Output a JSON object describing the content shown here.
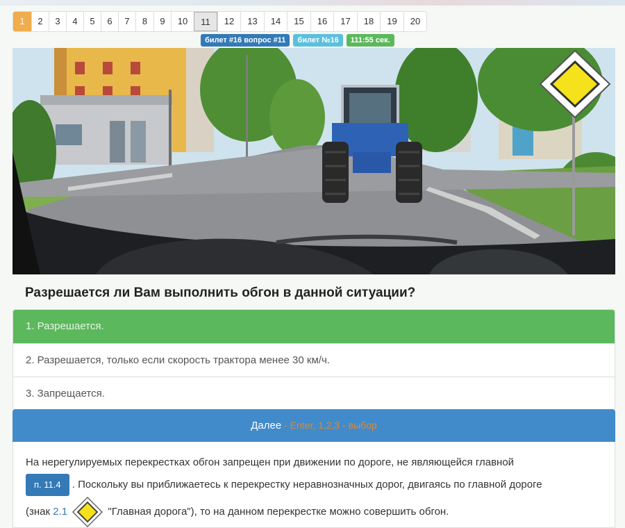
{
  "pagination": {
    "pages": [
      "1",
      "2",
      "3",
      "4",
      "5",
      "6",
      "7",
      "8",
      "9",
      "10",
      "11",
      "12",
      "13",
      "14",
      "15",
      "16",
      "17",
      "18",
      "19",
      "20"
    ],
    "active_page": "1",
    "current_page": "11"
  },
  "badges": {
    "ticket_question": "билет #16 вопрос #11",
    "ticket": "билет №16",
    "timer": "111:55 сек."
  },
  "question": "Разрешается ли Вам выполнить обгон в данной ситуации?",
  "answers": [
    "1. Разрешается.",
    "2. Разрешается, только если скорость трактора менее 30 км/ч.",
    "3. Запрещается."
  ],
  "next_button": {
    "label": "Далее",
    "hint": " - Enter, 1,2,3 - выбор"
  },
  "explanation": {
    "part1": "На нерегулируемых перекрестках обгон запрещен при движении по дороге, не являющейся главной",
    "rule_ref": "п. 11.4",
    "part2": ". Поскольку вы приближаетесь к перекрестку неравнозначных дорог, двигаясь по главной дороге",
    "part3_prefix": "(знак ",
    "sign_link": "2.1",
    "part3_suffix": " \"Главная дорога\"), то на данном перекрестке можно совершить обгон."
  },
  "colors": {
    "active_page": "#f0ad4e",
    "correct_answer": "#5cb85c",
    "next_button": "#428bca"
  },
  "icons": {
    "scene_sign": "main-road-sign-icon",
    "inline_sign": "main-road-sign-icon"
  }
}
